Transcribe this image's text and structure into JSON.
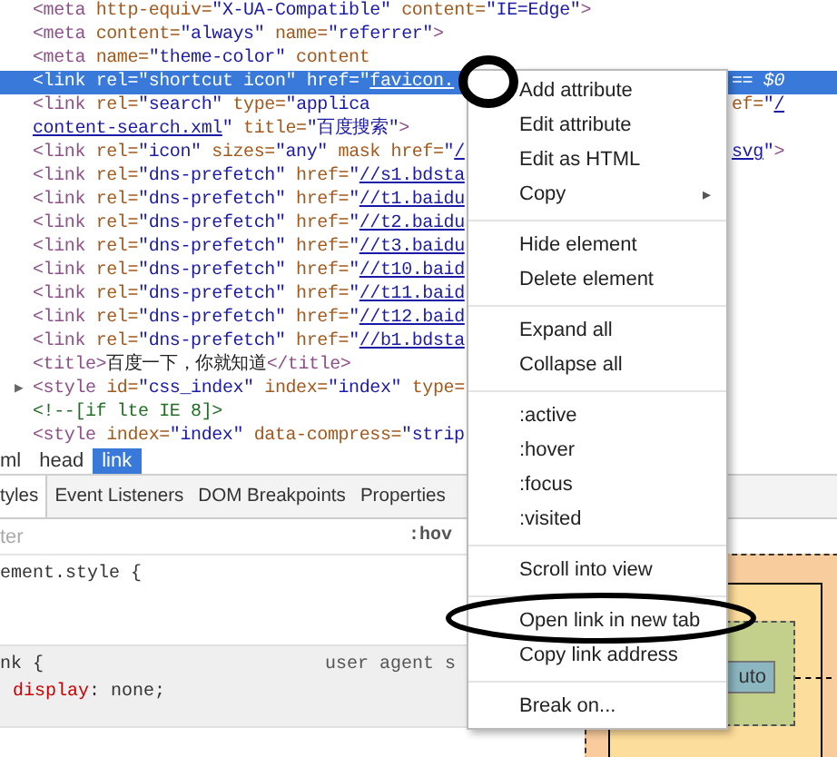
{
  "elements_tree": {
    "lines": [
      {
        "selected": false,
        "tokens": [
          {
            "kind": "tag",
            "text": "<meta"
          },
          {
            "kind": "attr",
            "text": " http-equiv="
          },
          {
            "kind": "value",
            "text": "\"X-UA-Compatible\""
          },
          {
            "kind": "attr",
            "text": " content="
          },
          {
            "kind": "value",
            "text": "\"IE=Edge\""
          },
          {
            "kind": "tag",
            "text": ">"
          }
        ]
      },
      {
        "selected": false,
        "tokens": [
          {
            "kind": "tag",
            "text": "<meta"
          },
          {
            "kind": "attr",
            "text": " content="
          },
          {
            "kind": "value",
            "text": "\"always\""
          },
          {
            "kind": "attr",
            "text": " name="
          },
          {
            "kind": "value",
            "text": "\"referrer\""
          },
          {
            "kind": "tag",
            "text": ">"
          }
        ]
      },
      {
        "selected": false,
        "tokens": [
          {
            "kind": "tag",
            "text": "<meta"
          },
          {
            "kind": "attr",
            "text": " name="
          },
          {
            "kind": "value",
            "text": "\"theme-color\""
          },
          {
            "kind": "attr",
            "text": " content"
          }
        ]
      },
      {
        "selected": true,
        "tokens": [
          {
            "kind": "tag",
            "text": "<link"
          },
          {
            "kind": "attr",
            "text": " rel="
          },
          {
            "kind": "value",
            "text": "\"shortcut icon\""
          },
          {
            "kind": "attr",
            "text": " href="
          },
          {
            "kind": "value",
            "text": "\""
          },
          {
            "kind": "link",
            "text": "favicon."
          }
        ],
        "tail": [
          {
            "kind": "text",
            "text": "== $0"
          }
        ]
      },
      {
        "selected": false,
        "tokens": [
          {
            "kind": "tag",
            "text": "<link"
          },
          {
            "kind": "attr",
            "text": " rel="
          },
          {
            "kind": "value",
            "text": "\"search\""
          },
          {
            "kind": "attr",
            "text": " type="
          },
          {
            "kind": "value",
            "text": "\"applica"
          }
        ],
        "tail": [
          {
            "kind": "attr",
            "text": "ef="
          },
          {
            "kind": "value",
            "text": "\""
          },
          {
            "kind": "link",
            "text": "/"
          }
        ]
      },
      {
        "selected": false,
        "tokens": [
          {
            "kind": "link",
            "text": "content-search.xml"
          },
          {
            "kind": "value",
            "text": "\""
          },
          {
            "kind": "attr",
            "text": " title="
          },
          {
            "kind": "value",
            "text": "\"百度搜索\""
          },
          {
            "kind": "tag",
            "text": ">"
          }
        ]
      },
      {
        "selected": false,
        "tokens": [
          {
            "kind": "tag",
            "text": "<link"
          },
          {
            "kind": "attr",
            "text": " rel="
          },
          {
            "kind": "value",
            "text": "\"icon\""
          },
          {
            "kind": "attr",
            "text": " sizes="
          },
          {
            "kind": "value",
            "text": "\"any\""
          },
          {
            "kind": "attr",
            "text": " mask href="
          },
          {
            "kind": "value",
            "text": "\""
          },
          {
            "kind": "link",
            "text": "/"
          }
        ],
        "tail": [
          {
            "kind": "link",
            "text": "svg"
          },
          {
            "kind": "value",
            "text": "\""
          },
          {
            "kind": "tag",
            "text": ">"
          }
        ]
      },
      {
        "selected": false,
        "tokens": [
          {
            "kind": "tag",
            "text": "<link"
          },
          {
            "kind": "attr",
            "text": " rel="
          },
          {
            "kind": "value",
            "text": "\"dns-prefetch\""
          },
          {
            "kind": "attr",
            "text": " href="
          },
          {
            "kind": "value",
            "text": "\""
          },
          {
            "kind": "link",
            "text": "//s1.bdsta"
          }
        ]
      },
      {
        "selected": false,
        "tokens": [
          {
            "kind": "tag",
            "text": "<link"
          },
          {
            "kind": "attr",
            "text": " rel="
          },
          {
            "kind": "value",
            "text": "\"dns-prefetch\""
          },
          {
            "kind": "attr",
            "text": " href="
          },
          {
            "kind": "value",
            "text": "\""
          },
          {
            "kind": "link",
            "text": "//t1.baidu"
          }
        ]
      },
      {
        "selected": false,
        "tokens": [
          {
            "kind": "tag",
            "text": "<link"
          },
          {
            "kind": "attr",
            "text": " rel="
          },
          {
            "kind": "value",
            "text": "\"dns-prefetch\""
          },
          {
            "kind": "attr",
            "text": " href="
          },
          {
            "kind": "value",
            "text": "\""
          },
          {
            "kind": "link",
            "text": "//t2.baidu"
          }
        ]
      },
      {
        "selected": false,
        "tokens": [
          {
            "kind": "tag",
            "text": "<link"
          },
          {
            "kind": "attr",
            "text": " rel="
          },
          {
            "kind": "value",
            "text": "\"dns-prefetch\""
          },
          {
            "kind": "attr",
            "text": " href="
          },
          {
            "kind": "value",
            "text": "\""
          },
          {
            "kind": "link",
            "text": "//t3.baidu"
          }
        ]
      },
      {
        "selected": false,
        "tokens": [
          {
            "kind": "tag",
            "text": "<link"
          },
          {
            "kind": "attr",
            "text": " rel="
          },
          {
            "kind": "value",
            "text": "\"dns-prefetch\""
          },
          {
            "kind": "attr",
            "text": " href="
          },
          {
            "kind": "value",
            "text": "\""
          },
          {
            "kind": "link",
            "text": "//t10.baid"
          }
        ]
      },
      {
        "selected": false,
        "tokens": [
          {
            "kind": "tag",
            "text": "<link"
          },
          {
            "kind": "attr",
            "text": " rel="
          },
          {
            "kind": "value",
            "text": "\"dns-prefetch\""
          },
          {
            "kind": "attr",
            "text": " href="
          },
          {
            "kind": "value",
            "text": "\""
          },
          {
            "kind": "link",
            "text": "//t11.baid"
          }
        ]
      },
      {
        "selected": false,
        "tokens": [
          {
            "kind": "tag",
            "text": "<link"
          },
          {
            "kind": "attr",
            "text": " rel="
          },
          {
            "kind": "value",
            "text": "\"dns-prefetch\""
          },
          {
            "kind": "attr",
            "text": " href="
          },
          {
            "kind": "value",
            "text": "\""
          },
          {
            "kind": "link",
            "text": "//t12.baid"
          }
        ]
      },
      {
        "selected": false,
        "tokens": [
          {
            "kind": "tag",
            "text": "<link"
          },
          {
            "kind": "attr",
            "text": " rel="
          },
          {
            "kind": "value",
            "text": "\"dns-prefetch\""
          },
          {
            "kind": "attr",
            "text": " href="
          },
          {
            "kind": "value",
            "text": "\""
          },
          {
            "kind": "link",
            "text": "//b1.bdsta"
          }
        ]
      },
      {
        "selected": false,
        "tokens": [
          {
            "kind": "tag",
            "text": "<title>"
          },
          {
            "kind": "text",
            "text": "百度一下，你就知道"
          },
          {
            "kind": "tag",
            "text": "</title>"
          }
        ]
      },
      {
        "selected": false,
        "toggle": "▶",
        "tokens": [
          {
            "kind": "tag",
            "text": "<style"
          },
          {
            "kind": "attr",
            "text": " id="
          },
          {
            "kind": "value",
            "text": "\"css_index\""
          },
          {
            "kind": "attr",
            "text": " index="
          },
          {
            "kind": "value",
            "text": "\"index\""
          },
          {
            "kind": "attr",
            "text": " type="
          }
        ]
      },
      {
        "selected": false,
        "tokens": [
          {
            "kind": "comment",
            "text": "<!--[if lte IE 8]>"
          }
        ]
      },
      {
        "selected": false,
        "tokens": [
          {
            "kind": "tag",
            "text": "<style"
          },
          {
            "kind": "attr",
            "text": " index="
          },
          {
            "kind": "value",
            "text": "\"index\""
          },
          {
            "kind": "attr",
            "text": " data-compress="
          },
          {
            "kind": "value",
            "text": "\"strip"
          }
        ]
      }
    ]
  },
  "breadcrumbs": [
    {
      "label": "ml",
      "selected": false
    },
    {
      "label": "head",
      "selected": false
    },
    {
      "label": "link",
      "selected": true
    }
  ],
  "tabs": [
    {
      "label": "tyles",
      "selected": true
    },
    {
      "label": "Event Listeners",
      "selected": false
    },
    {
      "label": "DOM Breakpoints",
      "selected": false
    },
    {
      "label": "Properties",
      "selected": false
    }
  ],
  "filter": {
    "placeholder": "ter",
    "hov": ":hov"
  },
  "rules": [
    {
      "selector": "ement.style {"
    },
    {
      "selector": "nk {",
      "source": "user agent s",
      "declarations": [
        {
          "property": "display",
          "value": ": none;"
        }
      ]
    }
  ],
  "box_model": {
    "content": "uto"
  },
  "context_menu": {
    "items": [
      {
        "kind": "item",
        "label": "Add attribute"
      },
      {
        "kind": "item",
        "label": "Edit attribute"
      },
      {
        "kind": "item",
        "label": "Edit as HTML"
      },
      {
        "kind": "item",
        "label": "Copy",
        "arrow": "▸"
      },
      {
        "kind": "separator"
      },
      {
        "kind": "item",
        "label": "Hide element"
      },
      {
        "kind": "item",
        "label": "Delete element"
      },
      {
        "kind": "separator"
      },
      {
        "kind": "item",
        "label": "Expand all"
      },
      {
        "kind": "item",
        "label": "Collapse all"
      },
      {
        "kind": "separator"
      },
      {
        "kind": "item",
        "label": ":active"
      },
      {
        "kind": "item",
        "label": ":hover"
      },
      {
        "kind": "item",
        "label": ":focus"
      },
      {
        "kind": "item",
        "label": ":visited"
      },
      {
        "kind": "separator"
      },
      {
        "kind": "item",
        "label": "Scroll into view"
      },
      {
        "kind": "separator"
      },
      {
        "kind": "item",
        "label": "Open link in new tab"
      },
      {
        "kind": "item",
        "label": "Copy link address"
      },
      {
        "kind": "separator"
      },
      {
        "kind": "item",
        "label": "Break on..."
      }
    ]
  }
}
